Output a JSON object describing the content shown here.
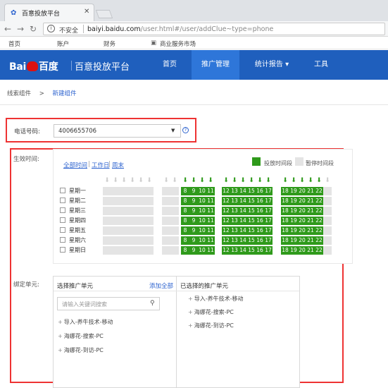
{
  "browser": {
    "tab_title": "百意投放平台",
    "security_label": "不安全",
    "url_host": "baiyi.baidu.com",
    "url_rest": "/user.html#/user/addClue~type=phone"
  },
  "bookmarks": [
    "首页",
    "账户",
    "财务",
    "商业服务市场"
  ],
  "header": {
    "logo_text_left": "Bai",
    "logo_text_right": "百度",
    "platform": "百意投放平台",
    "nav": [
      {
        "label": "首页"
      },
      {
        "label": "推广管理"
      },
      {
        "label": "统计报告 ▾"
      },
      {
        "label": "工具"
      }
    ],
    "active_index": 1
  },
  "breadcrumb": {
    "parent": "线索组件",
    "separator": ">",
    "current": "新建组件"
  },
  "phone": {
    "label": "电话号码:",
    "value": "4006655706",
    "help": "?"
  },
  "schedule": {
    "label": "生效时间:",
    "quick_links": [
      "全部时间",
      "工作日",
      "周末"
    ],
    "legend": {
      "on": "投放时间段",
      "off": "暂停时间段"
    },
    "days": [
      "星期一",
      "星期二",
      "星期三",
      "星期四",
      "星期五",
      "星期六",
      "星期日"
    ],
    "hour_labels": [
      "0",
      "1",
      "2",
      "3",
      "4",
      "5",
      "6",
      "7",
      "8",
      "9",
      "10",
      "11",
      "12",
      "13",
      "14",
      "15",
      "16",
      "17",
      "18",
      "19",
      "20",
      "21",
      "22",
      "23"
    ],
    "active_hours": [
      8,
      9,
      10,
      11,
      12,
      13,
      14,
      15,
      16,
      17,
      18,
      19,
      20,
      21,
      22
    ],
    "colors": {
      "on": "#2f9a1b",
      "off": "#e4e4e4"
    }
  },
  "binding": {
    "label": "绑定单元:",
    "select_title": "选择推广单元",
    "add_all": "添加全部",
    "chosen_title": "已选择的推广单元",
    "search_placeholder": "请输入关键词搜索",
    "available_units": [
      "导入-养牛技术-移动",
      "海娜花-搜索-PC",
      "海娜花-到访-PC"
    ],
    "selected_units": [
      "导入-养牛技术-移动",
      "海娜花-搜索-PC",
      "海娜花-到访-PC"
    ]
  }
}
